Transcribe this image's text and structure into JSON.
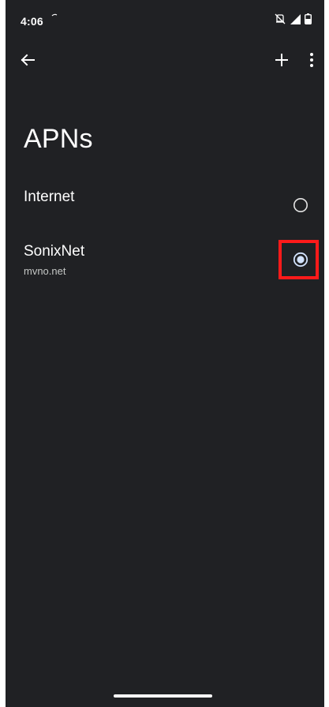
{
  "status_bar": {
    "time": "4:06"
  },
  "app_bar": {
    "back_icon": "arrow-back-icon",
    "add_icon": "plus-icon",
    "more_icon": "more-vert-icon"
  },
  "page": {
    "title": "APNs"
  },
  "apns": [
    {
      "name": "Internet",
      "subtitle": "",
      "selected": false
    },
    {
      "name": "SonixNet",
      "subtitle": "mvno.net",
      "selected": true
    }
  ],
  "colors": {
    "background": "#202124",
    "text": "#ffffff",
    "radio_selected": "#d3e3fd",
    "highlight": "#ff1a1a"
  }
}
